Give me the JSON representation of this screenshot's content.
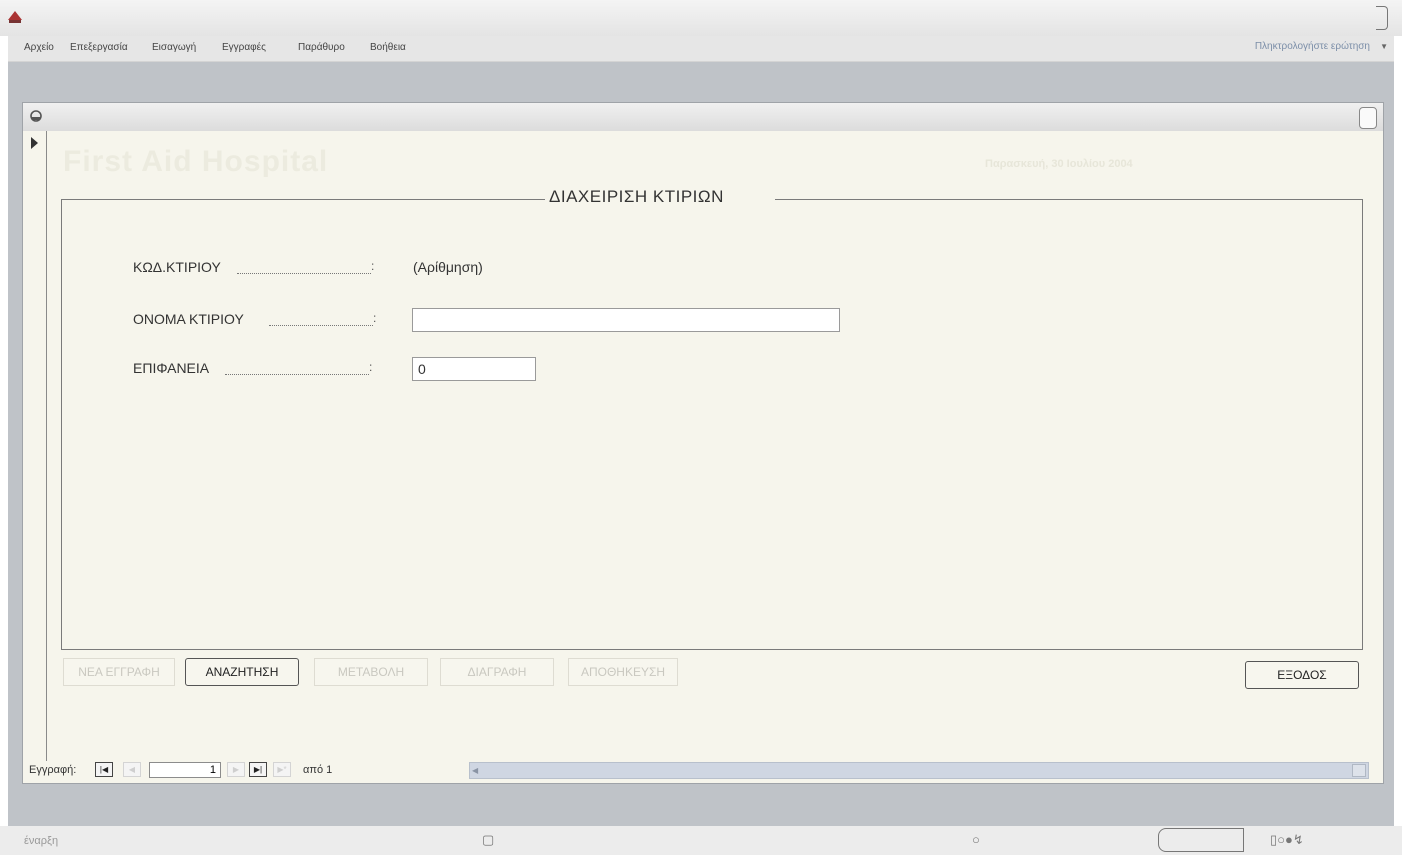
{
  "app": {
    "title": "",
    "menu": [
      {
        "label": "Αρχείο"
      },
      {
        "label": "Επεξεργασία"
      },
      {
        "label": "Εισαγωγή"
      },
      {
        "label": "Εγγραφές"
      },
      {
        "label": "Παράθυρο"
      },
      {
        "label": "Βοήθεια"
      }
    ],
    "ask_placeholder": "Πληκτρολογήστε ερώτηση"
  },
  "form": {
    "window_title": "",
    "header_title": "First Aid Hospital",
    "header_date": "Παρασκευή, 30 Ιουλίου 2004",
    "section_title": "ΔΙΑΧΕΙΡΙΣΗ ΚΤΙΡΙΩΝ",
    "fields": [
      {
        "label": "ΚΩΔ.ΚΤΙΡΙΟΥ",
        "value": "(Αρίθμηση)"
      },
      {
        "label": "ΟΝΟΜΑ ΚΤΙΡΙΟΥ",
        "value": ""
      },
      {
        "label": "ΕΠΙΦΑΝΕΙΑ",
        "value": "0"
      }
    ],
    "buttons": {
      "new": "ΝΕΑ ΕΓΓΡΑΦΗ",
      "search": "ΑΝΑΖΗΤΗΣΗ",
      "modify": "ΜΕΤΑΒΟΛΗ",
      "delete": "ΔΙΑΓΡΑΦΗ",
      "save": "ΑΠΟΘΗΚΕΥΣΗ",
      "exit": "ΕΞΟΔΟΣ"
    },
    "button_states": {
      "new": "disabled",
      "search": "enabled",
      "modify": "disabled",
      "delete": "disabled",
      "save": "disabled",
      "exit": "enabled"
    }
  },
  "navigator": {
    "label": "Εγγραφή:",
    "current": "1",
    "of_label": "από 1"
  },
  "taskbar": {
    "start_label": "έναρξη"
  },
  "colors": {
    "form_background": "#f6f5ec",
    "workspace": "#bfc3c8",
    "disabled_text": "#c9c8c0"
  },
  "icons": [
    "app-icon",
    "form-icon",
    "record-pointer-icon",
    "first-record-icon",
    "prev-record-icon",
    "next-record-icon",
    "last-record-icon",
    "new-record-icon"
  ]
}
